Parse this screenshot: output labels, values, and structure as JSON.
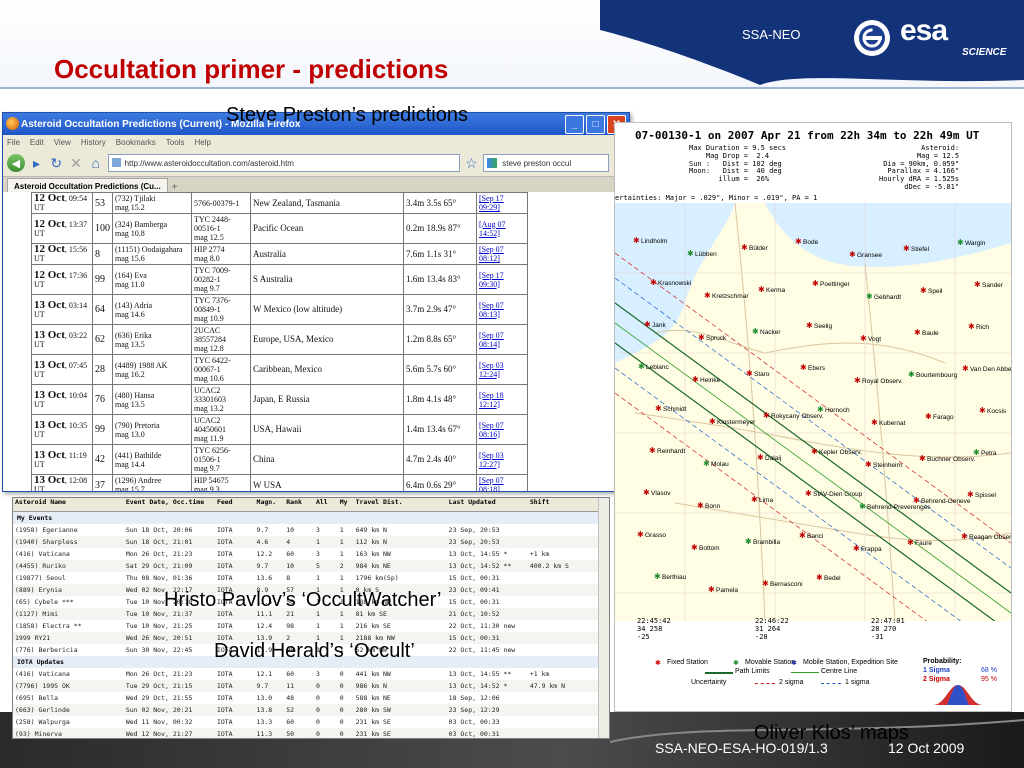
{
  "slide": {
    "title": "Occultation primer - predictions",
    "brand": "SSA-NEO",
    "logo_word": "esa",
    "logo_sub": "SCIENCE",
    "footer_id": "SSA-NEO-ESA-HO-019/1.3",
    "footer_date": "12 Oct 2009",
    "colors": {
      "title": "#c00000",
      "band": "#1d3f8f"
    }
  },
  "labels": {
    "preston": "Steve Preston’s predictions",
    "pavlov": "Hristo Pavlov’s ‘OccultWatcher’",
    "herald": "David Herald’s ‘Occult’",
    "klos": "Oliver Klos’ maps"
  },
  "firefox": {
    "title": "Asteroid Occultation Predictions (Current) - Mozilla Firefox",
    "menu": [
      "File",
      "Edit",
      "View",
      "History",
      "Bookmarks",
      "Tools",
      "Help"
    ],
    "url": "http://www.asteroidoccultation.com/asteroid.htm",
    "search": "steve preston occul",
    "tab": "Asteroid Occultation Predictions (Cu...",
    "rows": [
      {
        "date": "12 Oct",
        "time": "09:54",
        "dur": "53",
        "ast": "(732) Tjilaki",
        "astmag": "mag 15.2",
        "star": "5766-00379-1",
        "starmag": "",
        "region": "New Zealand, Tasmania",
        "sig": "3.4m 3.5s 65°",
        "upd": "[Sep 17 09:29]"
      },
      {
        "date": "12 Oct",
        "time": "13:37",
        "dur": "100",
        "ast": "(324) Bamberga",
        "astmag": "mag 10.8",
        "star": "TYC 2448-00516-1",
        "starmag": "mag 12.5",
        "region": "Pacific Ocean",
        "sig": "0.2m 18.9s 87°",
        "upd": "[Aug 07 14:52]"
      },
      {
        "date": "12 Oct",
        "time": "15:56",
        "dur": "8",
        "ast": "(11151) Oodaigahara",
        "astmag": "mag 15.6",
        "star": "HIP 2774",
        "starmag": "mag 8.0",
        "region": "Australia",
        "sig": "7.6m 1.1s 31°",
        "upd": "[Sep 07 08:12]"
      },
      {
        "date": "12 Oct",
        "time": "17:36",
        "dur": "99",
        "ast": "(164) Eva",
        "astmag": "mag 11.0",
        "star": "TYC 7009-00282-1",
        "starmag": "mag 9.7",
        "region": "S Australia",
        "sig": "1.6m 13.4s 83°",
        "upd": "[Sep 17 09:30]"
      },
      {
        "date": "13 Oct",
        "time": "03:14",
        "dur": "64",
        "ast": "(143) Adria",
        "astmag": "mag 14.6",
        "star": "TYC 7376-00849-1",
        "starmag": "mag 10.9",
        "region": "W Mexico (low altitude)",
        "sig": "3.7m 2.9s 47°",
        "upd": "[Sep 07 08:13]"
      },
      {
        "date": "13 Oct",
        "time": "03:22",
        "dur": "62",
        "ast": "(636) Erika",
        "astmag": "mag 13.5",
        "star": "2UCAC 38557284",
        "starmag": "mag 12.8",
        "region": "Europe, USA, Mexico",
        "sig": "1.2m 8.8s 65°",
        "upd": "[Sep 07 08:14]"
      },
      {
        "date": "13 Oct",
        "time": "07:45",
        "dur": "28",
        "ast": "(4489) 1988 AK",
        "astmag": "mag 16.2",
        "star": "TYC 6422-00067-1",
        "starmag": "mag 10.6",
        "region": "Caribbean, Mexico",
        "sig": "5.6m 5.7s 60°",
        "upd": "[Sep 03 12:24]"
      },
      {
        "date": "13 Oct",
        "time": "10:04",
        "dur": "76",
        "ast": "(480) Hansa",
        "astmag": "mag 13.5",
        "star": "UCAC2 33301603",
        "starmag": "mag 13.2",
        "region": "Japan, E Russia",
        "sig": "1.8m 4.1s 48°",
        "upd": "[Sep 18 12:12]"
      },
      {
        "date": "13 Oct",
        "time": "10:35",
        "dur": "99",
        "ast": "(790) Pretoria",
        "astmag": "mag 13.0",
        "star": "UCAC2 40450601",
        "starmag": "mag 11.9",
        "region": "USA, Hawaii",
        "sig": "1.4m 13.4s 67°",
        "upd": "[Sep 07 08:16]"
      },
      {
        "date": "13 Oct",
        "time": "11:19",
        "dur": "42",
        "ast": "(441) Bathilde",
        "astmag": "mag 14.4",
        "star": "TYC 6256-01506-1",
        "starmag": "mag 9.7",
        "region": "China",
        "sig": "4.7m 2.4s 40°",
        "upd": "[Sep 03 12:27]"
      },
      {
        "date": "13 Oct",
        "time": "12:08",
        "dur": "37",
        "ast": "(1296) Andree",
        "astmag": "mag 15.7",
        "star": "HIP 54675",
        "starmag": "mag 9.3",
        "region": "W USA",
        "sig": "6.4m 0.6s 29°",
        "upd": "[Sep 07 08:18]"
      }
    ]
  },
  "occultwatcher": {
    "columns": [
      "Asteroid Name",
      "Event Date, Occ.time",
      "Feed",
      "Magn.",
      "Rank",
      "All",
      "My",
      "Travel Dist.",
      "Last Updated",
      "Shift"
    ],
    "groups": [
      {
        "name": "My Events",
        "rows": [
          [
            "(1958) Egerianne",
            "Sun 18 Oct, 20:06",
            "IOTA",
            "9.7",
            "10",
            "3",
            "1",
            "649 km N",
            "23 Sep, 20:53",
            ""
          ],
          [
            "(1940) Sharpless",
            "Sun 18 Oct, 21:01",
            "IOTA",
            "4.6",
            "4",
            "1",
            "1",
            "112 km N",
            "23 Sep, 20:53",
            ""
          ],
          [
            "(416) Vaticana",
            "Mon 26 Oct, 21:23",
            "IOTA",
            "12.2",
            "60",
            "3",
            "1",
            "163 km NW",
            "13 Oct, 14:55 *",
            "+1 km"
          ],
          [
            "(4455) Ruriko",
            "Sat 29 Oct, 21:09",
            "IOTA",
            "9.7",
            "10",
            "5",
            "2",
            "984 km NE",
            "13 Oct, 14:52 **",
            "400.2 km S"
          ],
          [
            "(19877) Seoul",
            "Thu 08 Nov, 01:36",
            "IOTA",
            "13.6",
            "8",
            "1",
            "1",
            "1796 km(Sp)",
            "15 Oct, 00:31",
            ""
          ],
          [
            "(889) Erynia",
            "Wed 02 Nov, 22:17",
            "IOTA",
            "8.9",
            "57",
            "1",
            "1",
            "0 km S",
            "23 Oct, 09:41",
            ""
          ],
          [
            "(65) Cybele ***",
            "Tue 10 Nov, 20:18",
            "IOTA",
            "11.5",
            "50",
            "1",
            "1",
            "188 km NW",
            "15 Oct, 00:31",
            ""
          ],
          [
            "(1127) Mimi",
            "Tue 10 Nov, 21:37",
            "IOTA",
            "11.1",
            "21",
            "1",
            "1",
            "81 km SE",
            "21 Oct, 10:52",
            ""
          ],
          [
            "(1858) Electra **",
            "Tue 10 Nov, 21:25",
            "IOTA",
            "12.4",
            "98",
            "1",
            "1",
            "216 km SE",
            "22 Oct, 11:30 new",
            ""
          ],
          [
            "1999 RY21",
            "Wed 26 Nov, 20:51",
            "IOTA",
            "13.9",
            "2",
            "1",
            "1",
            "2188 km NW",
            "15 Oct, 00:31",
            ""
          ],
          [
            "(776) Berbericia",
            "Sun 30 Nov, 22:45",
            "IOTA",
            "11.9",
            "98",
            "1",
            "1",
            "52 km NW",
            "22 Oct, 11:45 new",
            ""
          ]
        ]
      },
      {
        "name": "IOTA Updates",
        "rows": [
          [
            "(416) Vaticana",
            "Mon 26 Oct, 21:23",
            "IOTA",
            "12.1",
            "60",
            "3",
            "0",
            "441 km NW",
            "13 Oct, 14:55 **",
            "+1 km"
          ],
          [
            "(7796) 1995 OK",
            "Tue 29 Oct, 21:15",
            "IOTA",
            "9.7",
            "11",
            "0",
            "0",
            "986 km N",
            "13 Oct, 14:52 *",
            "47.9 km N"
          ],
          [
            "(695) Bella",
            "Wed 29 Oct, 21:55",
            "IOTA",
            "13.0",
            "48",
            "0",
            "0",
            "588 km NE",
            "18 Sep, 12:06",
            ""
          ],
          [
            "(663) Gerlinde",
            "Sun 02 Nov, 20:21",
            "IOTA",
            "13.8",
            "52",
            "0",
            "0",
            "280 km SW",
            "23 Sep, 12:29",
            ""
          ],
          [
            "(258) Walpurga",
            "Wed 11 Nov, 00:32",
            "IOTA",
            "13.3",
            "60",
            "0",
            "0",
            "231 km SE",
            "03 Oct, 00:33",
            ""
          ],
          [
            "(93) Minerva",
            "Wed 12 Nov, 21:27",
            "IOTA",
            "11.3",
            "50",
            "0",
            "0",
            "231 km SE",
            "03 Oct, 00:31",
            ""
          ]
        ]
      }
    ]
  },
  "klos_map": {
    "headline": "07-00130-1 on 2007 Apr 21 from 22h 34m to 22h 49m UT",
    "header_left": "Max Duration = 9.5 secs\n    Mag Drop =  2.4\nSun :   Dist = 102 deg\nMoon:   Dist =  40 deg\n       illum =  26%",
    "header_right": "Asteroid:\n   Mag = 12.5\nDia = 90km, 0.059\"\nParallax = 4.166\"\nHourly dRA = 1.525s\ndDec = -5.81\"",
    "uncertainties": "ertainties: Major = .029\", Minor = .019\", PA = 1",
    "times": [
      {
        "t": "22:45:42",
        "coords": "34  258",
        "alt": "-25"
      },
      {
        "t": "22:46:22",
        "coords": "31  264",
        "alt": "-28"
      },
      {
        "t": "22:47:01",
        "coords": "28  270",
        "alt": "-31"
      }
    ],
    "cities": [
      "Lindholm",
      "Lübben",
      "Bülder",
      "Bode",
      "Gransee",
      "Stiefel",
      "Wargin",
      "Krasnowski",
      "Kretzschmar",
      "Kerma",
      "Poettinger",
      "Gebhardt",
      "Speil",
      "Sander",
      "Jank",
      "Spruck",
      "Nacker",
      "Seelig",
      "Vogt",
      "Baule",
      "Rich",
      "Leblanc",
      "Heinke",
      "Staro",
      "Ebers",
      "Royal Observ.",
      "Bourtembourg",
      "Van Den Abbeel",
      "Schmidt",
      "Klostermeyer",
      "Rokycany Observ.",
      "Hornoch",
      "Kubernat",
      "Farago",
      "Kocsis",
      "Reinhardt",
      "Molau",
      "Dalaij",
      "Kepler Observ.",
      "Steinheim",
      "Buchner Observ.",
      "Petra",
      "Vlasov",
      "Bonn",
      "Lima",
      "SIAV-Dien Group",
      "Behrend-Preverenges",
      "Behrend-Geneve",
      "Spissel",
      "Grasso",
      "Bottom",
      "Brambilla",
      "Banci",
      "Frappa",
      "Faure",
      "Reagan Observ.",
      "Berthiau",
      "Pamela",
      "Bernasconi",
      "Bedel"
    ],
    "legend": {
      "fixed": "Fixed Station",
      "movable": "Movable Station",
      "mobile": "Mobile Station, Expedition Site",
      "path": "Path Limits",
      "centre": "Centre Line",
      "uncertainty": "Uncertainty",
      "sigma2": "2 sigma",
      "sigma1": "1 sigma",
      "probability": "Probability:",
      "p1": "1 Sigma",
      "p1v": "68 %",
      "p2": "2 Sigma",
      "p2v": "95 %"
    }
  }
}
